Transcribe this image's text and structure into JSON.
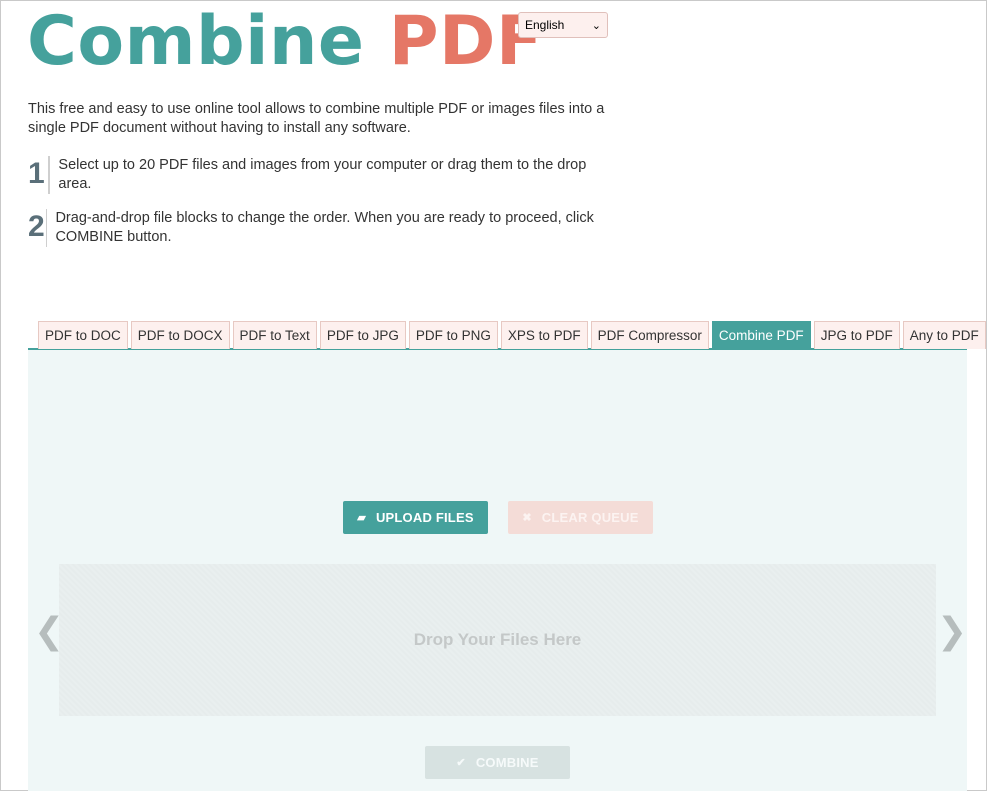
{
  "logo": {
    "word1": "Combine",
    "word2": "PDF"
  },
  "language": {
    "selected": "English"
  },
  "intro": "This free and easy to use online tool allows to combine multiple PDF or images files into a single PDF document without having to install any software.",
  "steps": [
    {
      "num": "1",
      "text": "Select up to 20 PDF files and images from your computer or drag them to the drop area."
    },
    {
      "num": "2",
      "text": "Drag-and-drop file blocks to change the order. When you are ready to proceed, click COMBINE button."
    }
  ],
  "tabs": [
    {
      "label": "PDF to DOC"
    },
    {
      "label": "PDF to DOCX"
    },
    {
      "label": "PDF to Text"
    },
    {
      "label": "PDF to JPG"
    },
    {
      "label": "PDF to PNG"
    },
    {
      "label": "XPS to PDF"
    },
    {
      "label": "PDF Compressor"
    },
    {
      "label": "Combine PDF",
      "active": true
    },
    {
      "label": "JPG to PDF"
    },
    {
      "label": "Any to PDF"
    }
  ],
  "buttons": {
    "upload": "UPLOAD FILES",
    "clear": "CLEAR QUEUE",
    "combine": "COMBINE"
  },
  "dropzone": {
    "text": "Drop Your Files Here"
  },
  "arrows": {
    "left": "❮",
    "right": "❯"
  },
  "colors": {
    "teal": "#45a19c",
    "coral": "#e57766",
    "panel": "#eff7f7"
  }
}
